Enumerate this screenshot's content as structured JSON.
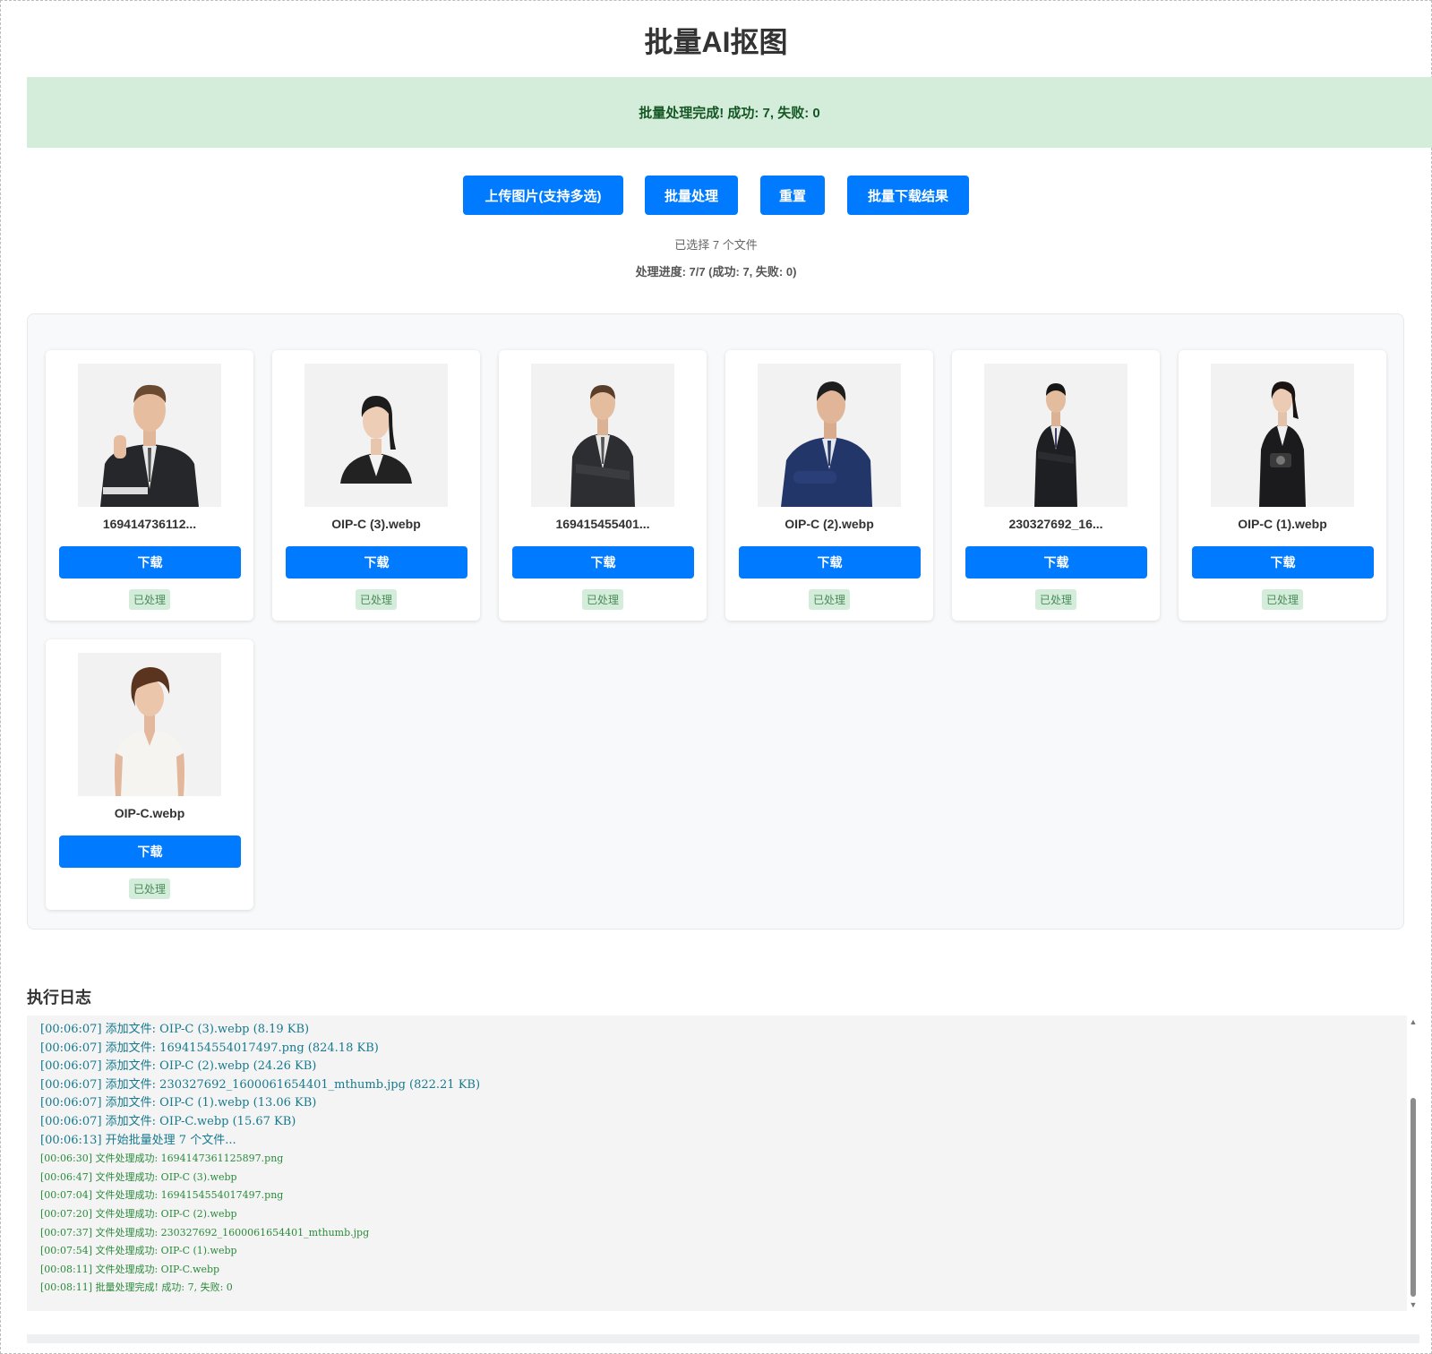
{
  "page": {
    "title": "批量AI抠图"
  },
  "banner": {
    "text": "批量处理完成! 成功: 7, 失败: 0"
  },
  "toolbar": {
    "upload_label": "上传图片(支持多选)",
    "process_label": "批量处理",
    "reset_label": "重置",
    "download_all_label": "批量下载结果"
  },
  "status": {
    "selected": "已选择 7 个文件",
    "progress": "处理进度: 7/7 (成功: 7, 失败: 0)"
  },
  "results": [
    {
      "name": "169414736112...",
      "download": "下载",
      "status": "已处理"
    },
    {
      "name": "OIP-C (3).webp",
      "download": "下载",
      "status": "已处理"
    },
    {
      "name": "169415455401...",
      "download": "下载",
      "status": "已处理"
    },
    {
      "name": "OIP-C (2).webp",
      "download": "下载",
      "status": "已处理"
    },
    {
      "name": "230327692_16...",
      "download": "下载",
      "status": "已处理"
    },
    {
      "name": "OIP-C (1).webp",
      "download": "下载",
      "status": "已处理"
    },
    {
      "name": "OIP-C.webp",
      "download": "下载",
      "status": "已处理"
    }
  ],
  "log": {
    "title": "执行日志",
    "lines": [
      "[00:06:07] 添加文件: OIP-C (3).webp (8.19 KB)",
      "[00:06:07] 添加文件: 1694154554017497.png (824.18 KB)",
      "[00:06:07] 添加文件: OIP-C (2).webp (24.26 KB)",
      "[00:06:07] 添加文件: 230327692_1600061654401_mthumb.jpg (822.21 KB)",
      "[00:06:07] 添加文件: OIP-C (1).webp (13.06 KB)",
      "[00:06:07] 添加文件: OIP-C.webp (15.67 KB)",
      "[00:06:13] 开始批量处理 7 个文件...",
      "[00:06:30] 文件处理成功: 1694147361125897.png",
      "[00:06:47] 文件处理成功: OIP-C (3).webp",
      "[00:07:04] 文件处理成功: 1694154554017497.png",
      "[00:07:20] 文件处理成功: OIP-C (2).webp",
      "[00:07:37] 文件处理成功: 230327692_1600061654401_mthumb.jpg",
      "[00:07:54] 文件处理成功: OIP-C (1).webp",
      "[00:08:11] 文件处理成功: OIP-C.webp",
      "[00:08:11] 批量处理完成! 成功: 7, 失败: 0"
    ]
  },
  "colors": {
    "primary": "#007bff",
    "success_bg": "#d4edda",
    "success_text": "#155724",
    "log_info": "#17798e",
    "log_ok": "#2a8a3a"
  }
}
